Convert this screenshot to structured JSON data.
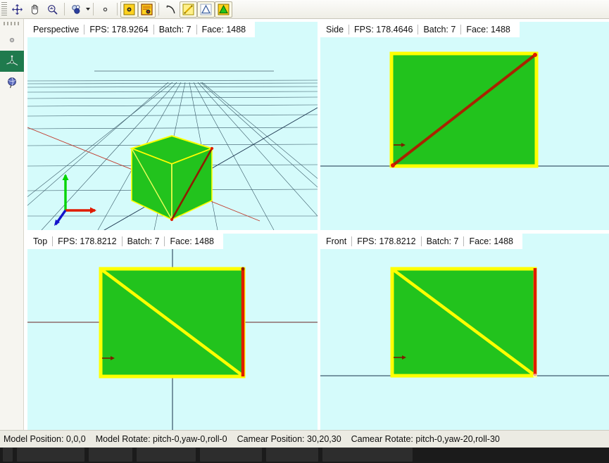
{
  "toolbar": {
    "groups": [
      {
        "items": [
          {
            "name": "move-icon",
            "glyph": "✥",
            "framed": false,
            "caret": false
          },
          {
            "name": "pan-hand-icon",
            "glyph": "✋",
            "framed": false,
            "caret": false
          },
          {
            "name": "zoom-magnifier-icon",
            "glyph": "⌕",
            "framed": false,
            "caret": false
          }
        ]
      },
      {
        "items": [
          {
            "name": "select-objects-icon",
            "glyph": "◍",
            "framed": false,
            "caret": true
          }
        ]
      },
      {
        "items": [
          {
            "name": "point-dot-icon",
            "glyph": "•",
            "framed": false,
            "caret": false
          }
        ]
      },
      {
        "items": [
          {
            "name": "vertex-marker-icon",
            "glyph": "⬤",
            "framed": true,
            "caret": false
          },
          {
            "name": "render-scene-icon",
            "glyph": "▦",
            "framed": true,
            "caret": false
          }
        ]
      },
      {
        "items": [
          {
            "name": "curve-arc-icon",
            "glyph": "◜",
            "framed": false,
            "caret": false
          },
          {
            "name": "line-segment-icon",
            "glyph": "╱",
            "framed": true,
            "caret": false
          },
          {
            "name": "triangle-outline-icon",
            "glyph": "△",
            "framed": true,
            "caret": false
          },
          {
            "name": "triangle-filled-icon",
            "glyph": "▲",
            "framed": true,
            "caret": false
          }
        ]
      }
    ]
  },
  "sidebar": {
    "items": [
      {
        "name": "sidebar-item-small-dot",
        "label": "",
        "selected": false
      },
      {
        "name": "sidebar-item-axis-gizmo",
        "label": "",
        "selected": true
      },
      {
        "name": "sidebar-item-globe",
        "label": "",
        "selected": false
      }
    ]
  },
  "viewports": [
    {
      "id": "perspective",
      "name": "Perspective",
      "fps_label": "FPS: 178.9264",
      "batch_label": "Batch: 7",
      "face_label": "Face: 1488",
      "background": "#d5fbfb"
    },
    {
      "id": "side",
      "name": "Side",
      "fps_label": "FPS: 178.4646",
      "batch_label": "Batch: 7",
      "face_label": "Face: 1488",
      "background": "#d5fbfb"
    },
    {
      "id": "top",
      "name": "Top",
      "fps_label": "FPS: 178.8212",
      "batch_label": "Batch: 7",
      "face_label": "Face: 1488",
      "background": "#d5fbfb"
    },
    {
      "id": "front",
      "name": "Front",
      "fps_label": "FPS: 178.8212",
      "batch_label": "Batch: 7",
      "face_label": "Face: 1488",
      "background": "#d5fbfb"
    }
  ],
  "scene": {
    "mesh_fill": "#22c31d",
    "mesh_edge_yellow": "#ffff00",
    "mesh_edge_red": "#e01b00",
    "axis_x_color": "#c0392b",
    "axis_y_color": "#00d400",
    "axis_z_color": "#0000cc",
    "grid_color": "#2f4f5f"
  },
  "statusbar": {
    "model_position": "Model Position: 0,0,0",
    "model_rotate": "Model Rotate: pitch-0,yaw-0,roll-0",
    "camera_position": "Camear Position: 30,20,30",
    "camera_rotate": "Camear Rotate: pitch-0,yaw-20,roll-30"
  },
  "taskbar": {
    "items": [
      {
        "label": ""
      },
      {
        "label": ""
      },
      {
        "label": ""
      },
      {
        "label": ""
      },
      {
        "label": ""
      },
      {
        "label": ""
      },
      {
        "label": ""
      }
    ]
  }
}
